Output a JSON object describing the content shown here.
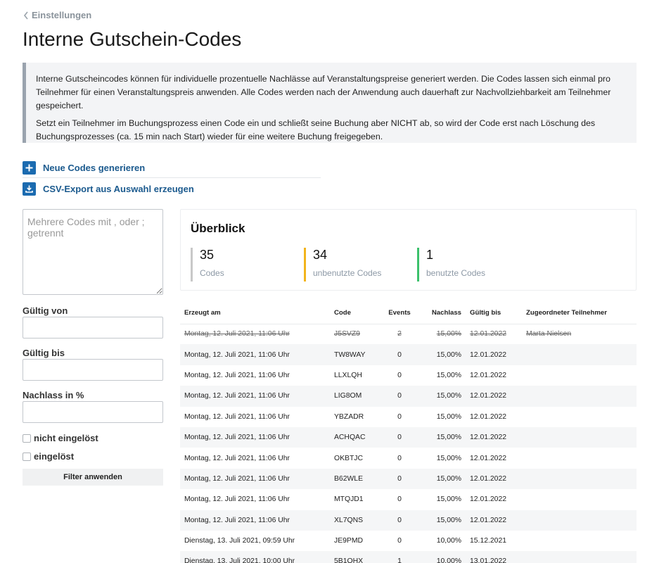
{
  "nav": {
    "back_label": "Einstellungen"
  },
  "page": {
    "title": "Interne Gutschein-Codes"
  },
  "info": {
    "p1": "Interne Gutscheincodes können für individuelle prozentuelle Nachlässe auf Veranstaltungspreise generiert werden. Die Codes lassen sich einmal pro Teilnehmer für einen Veranstaltungspreis anwenden. Alle Codes werden nach der Anwendung auch dauerhaft zur Nachvollziehbarkeit am Teilnehmer gespeichert.",
    "p2": "Setzt ein Teilnehmer im Buchungsprozess einen Code ein und schließt seine Buchung aber NICHT ab, so wird der Code erst nach Löschung des Buchungsprozesses (ca. 15 min nach Start) wieder für eine weitere Buchung freigegeben."
  },
  "actions": {
    "generate_label": "Neue Codes generieren",
    "export_label": "CSV-Export aus Auswahl erzeugen"
  },
  "filter": {
    "codes_placeholder": "Mehrere Codes mit , oder ; getrennt",
    "valid_from_label": "Gültig von",
    "valid_to_label": "Gültig bis",
    "discount_label": "Nachlass in %",
    "not_redeemed_label": "nicht eingelöst",
    "redeemed_label": "eingelöst",
    "apply_label": "Filter anwenden"
  },
  "overview": {
    "title": "Überblick",
    "stats": [
      {
        "value": "35",
        "label": "Codes",
        "color": "#c8c8c8"
      },
      {
        "value": "34",
        "label": "unbenutzte Codes",
        "color": "#f2b41c"
      },
      {
        "value": "1",
        "label": "benutzte Codes",
        "color": "#3cc16c"
      }
    ]
  },
  "table": {
    "columns": [
      "Erzeugt am",
      "Code",
      "Events",
      "Nachlass",
      "Gültig bis",
      "Zugeordneter Teilnehmer"
    ],
    "rows": [
      {
        "created": "Montag, 12. Juli 2021, 11:06 Uhr",
        "code": "J5SVZ9",
        "events": "2",
        "discount": "15,00%",
        "valid_to": "12.01.2022",
        "participant": "Marta Nielsen",
        "strike": true
      },
      {
        "created": "Montag, 12. Juli 2021, 11:06 Uhr",
        "code": "TW8WAY",
        "events": "0",
        "discount": "15,00%",
        "valid_to": "12.01.2022",
        "participant": ""
      },
      {
        "created": "Montag, 12. Juli 2021, 11:06 Uhr",
        "code": "LLXLQH",
        "events": "0",
        "discount": "15,00%",
        "valid_to": "12.01.2022",
        "participant": ""
      },
      {
        "created": "Montag, 12. Juli 2021, 11:06 Uhr",
        "code": "LIG8OM",
        "events": "0",
        "discount": "15,00%",
        "valid_to": "12.01.2022",
        "participant": ""
      },
      {
        "created": "Montag, 12. Juli 2021, 11:06 Uhr",
        "code": "YBZADR",
        "events": "0",
        "discount": "15,00%",
        "valid_to": "12.01.2022",
        "participant": ""
      },
      {
        "created": "Montag, 12. Juli 2021, 11:06 Uhr",
        "code": "ACHQAC",
        "events": "0",
        "discount": "15,00%",
        "valid_to": "12.01.2022",
        "participant": ""
      },
      {
        "created": "Montag, 12. Juli 2021, 11:06 Uhr",
        "code": "OKBTJC",
        "events": "0",
        "discount": "15,00%",
        "valid_to": "12.01.2022",
        "participant": ""
      },
      {
        "created": "Montag, 12. Juli 2021, 11:06 Uhr",
        "code": "B62WLE",
        "events": "0",
        "discount": "15,00%",
        "valid_to": "12.01.2022",
        "participant": ""
      },
      {
        "created": "Montag, 12. Juli 2021, 11:06 Uhr",
        "code": "MTQJD1",
        "events": "0",
        "discount": "15,00%",
        "valid_to": "12.01.2022",
        "participant": ""
      },
      {
        "created": "Montag, 12. Juli 2021, 11:06 Uhr",
        "code": "XL7QNS",
        "events": "0",
        "discount": "15,00%",
        "valid_to": "12.01.2022",
        "participant": ""
      },
      {
        "created": "Dienstag, 13. Juli 2021, 09:59 Uhr",
        "code": "JE9PMD",
        "events": "0",
        "discount": "10,00%",
        "valid_to": "15.12.2021",
        "participant": ""
      },
      {
        "created": "Dienstag, 13. Juli 2021, 10:00 Uhr",
        "code": "5B1QHX",
        "events": "1",
        "discount": "10,00%",
        "valid_to": "13.01.2022",
        "participant": ""
      }
    ]
  }
}
